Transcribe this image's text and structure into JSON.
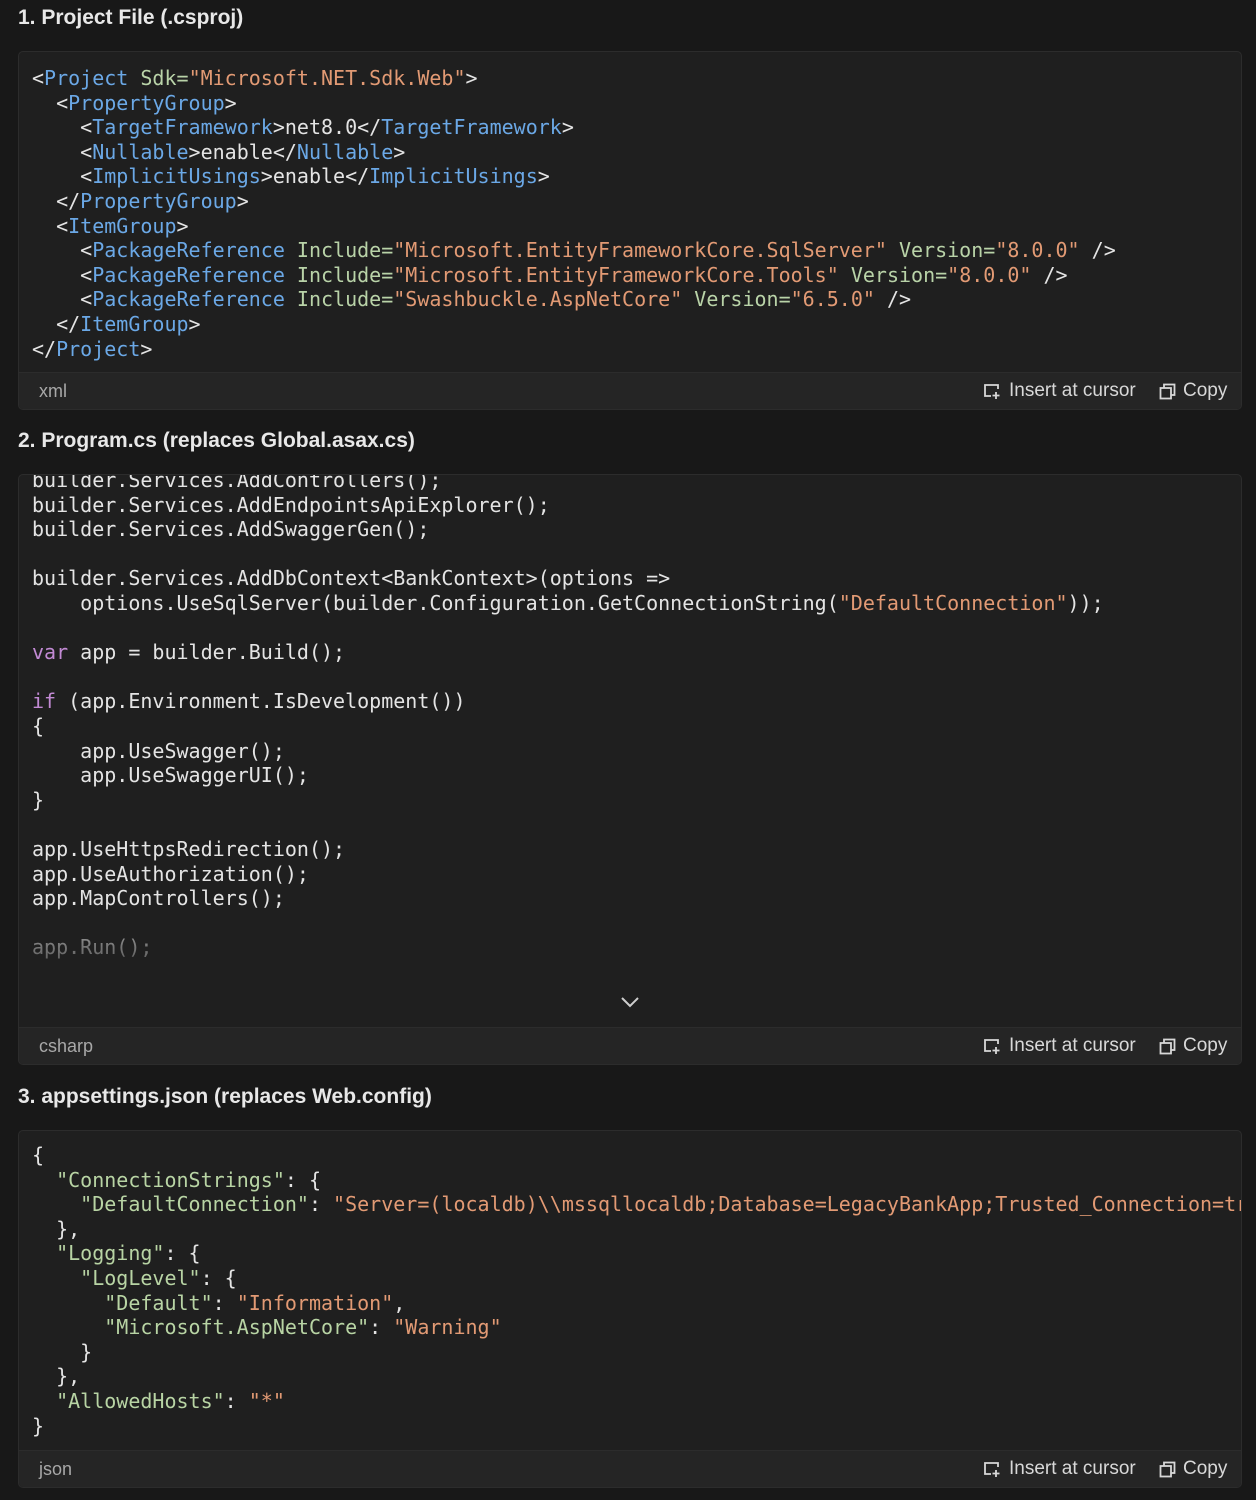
{
  "sections": [
    {
      "heading": "1. Project File (.csproj)",
      "language": "xml",
      "insert_label": "Insert at cursor",
      "copy_label": "Copy",
      "lines": [
        [
          {
            "t": "<",
            "c": "bracket"
          },
          {
            "t": "Project",
            "c": "tag"
          },
          {
            "t": " Sdk=",
            "c": "attr"
          },
          {
            "t": "\"Microsoft.NET.Sdk.Web\"",
            "c": "str"
          },
          {
            "t": ">",
            "c": "bracket"
          }
        ],
        [
          {
            "t": "  <",
            "c": "bracket"
          },
          {
            "t": "PropertyGroup",
            "c": "tag"
          },
          {
            "t": ">",
            "c": "bracket"
          }
        ],
        [
          {
            "t": "    <",
            "c": "bracket"
          },
          {
            "t": "TargetFramework",
            "c": "tag"
          },
          {
            "t": ">net8.0</",
            "c": "bracket"
          },
          {
            "t": "TargetFramework",
            "c": "tag"
          },
          {
            "t": ">",
            "c": "bracket"
          }
        ],
        [
          {
            "t": "    <",
            "c": "bracket"
          },
          {
            "t": "Nullable",
            "c": "tag"
          },
          {
            "t": ">enable</",
            "c": "bracket"
          },
          {
            "t": "Nullable",
            "c": "tag"
          },
          {
            "t": ">",
            "c": "bracket"
          }
        ],
        [
          {
            "t": "    <",
            "c": "bracket"
          },
          {
            "t": "ImplicitUsings",
            "c": "tag"
          },
          {
            "t": ">enable</",
            "c": "bracket"
          },
          {
            "t": "ImplicitUsings",
            "c": "tag"
          },
          {
            "t": ">",
            "c": "bracket"
          }
        ],
        [
          {
            "t": "  </",
            "c": "bracket"
          },
          {
            "t": "PropertyGroup",
            "c": "tag"
          },
          {
            "t": ">",
            "c": "bracket"
          }
        ],
        [
          {
            "t": "  <",
            "c": "bracket"
          },
          {
            "t": "ItemGroup",
            "c": "tag"
          },
          {
            "t": ">",
            "c": "bracket"
          }
        ],
        [
          {
            "t": "    <",
            "c": "bracket"
          },
          {
            "t": "PackageReference",
            "c": "tag"
          },
          {
            "t": " Include=",
            "c": "attr"
          },
          {
            "t": "\"Microsoft.EntityFrameworkCore.SqlServer\"",
            "c": "str"
          },
          {
            "t": " Version=",
            "c": "attr"
          },
          {
            "t": "\"8.0.0\"",
            "c": "str"
          },
          {
            "t": " />",
            "c": "bracket"
          }
        ],
        [
          {
            "t": "    <",
            "c": "bracket"
          },
          {
            "t": "PackageReference",
            "c": "tag"
          },
          {
            "t": " Include=",
            "c": "attr"
          },
          {
            "t": "\"Microsoft.EntityFrameworkCore.Tools\"",
            "c": "str"
          },
          {
            "t": " Version=",
            "c": "attr"
          },
          {
            "t": "\"8.0.0\"",
            "c": "str"
          },
          {
            "t": " />",
            "c": "bracket"
          }
        ],
        [
          {
            "t": "    <",
            "c": "bracket"
          },
          {
            "t": "PackageReference",
            "c": "tag"
          },
          {
            "t": " Include=",
            "c": "attr"
          },
          {
            "t": "\"Swashbuckle.AspNetCore\"",
            "c": "str"
          },
          {
            "t": " Version=",
            "c": "attr"
          },
          {
            "t": "\"6.5.0\"",
            "c": "str"
          },
          {
            "t": " />",
            "c": "bracket"
          }
        ],
        [
          {
            "t": "  </",
            "c": "bracket"
          },
          {
            "t": "ItemGroup",
            "c": "tag"
          },
          {
            "t": ">",
            "c": "bracket"
          }
        ],
        [
          {
            "t": "</",
            "c": "bracket"
          },
          {
            "t": "Project",
            "c": "tag"
          },
          {
            "t": ">",
            "c": "bracket"
          }
        ]
      ]
    },
    {
      "heading": "2. Program.cs (replaces Global.asax.cs)",
      "language": "csharp",
      "insert_label": "Insert at cursor",
      "copy_label": "Copy",
      "lines": [
        [
          {
            "t": "builder.Services.AddControllers();",
            "c": "plain"
          }
        ],
        [
          {
            "t": "builder.Services.AddEndpointsApiExplorer();",
            "c": "plain"
          }
        ],
        [
          {
            "t": "builder.Services.AddSwaggerGen();",
            "c": "plain"
          }
        ],
        [],
        [
          {
            "t": "builder.Services.AddDbContext<BankContext>(options =>",
            "c": "plain"
          }
        ],
        [
          {
            "t": "    options.UseSqlServer(builder.Configuration.GetConnectionString(",
            "c": "plain"
          },
          {
            "t": "\"DefaultConnection\"",
            "c": "str"
          },
          {
            "t": "));",
            "c": "plain"
          }
        ],
        [],
        [
          {
            "t": "var",
            "c": "kw"
          },
          {
            "t": " app = builder.Build();",
            "c": "plain"
          }
        ],
        [],
        [
          {
            "t": "if",
            "c": "kw"
          },
          {
            "t": " (app.Environment.IsDevelopment())",
            "c": "plain"
          }
        ],
        [
          {
            "t": "{",
            "c": "plain"
          }
        ],
        [
          {
            "t": "    app.UseSwagger();",
            "c": "plain"
          }
        ],
        [
          {
            "t": "    app.UseSwaggerUI();",
            "c": "plain"
          }
        ],
        [
          {
            "t": "}",
            "c": "plain"
          }
        ],
        [],
        [
          {
            "t": "app.UseHttpsRedirection();",
            "c": "plain"
          }
        ],
        [
          {
            "t": "app.UseAuthorization();",
            "c": "plain"
          }
        ],
        [
          {
            "t": "app.MapControllers();",
            "c": "plain"
          }
        ],
        [],
        [
          {
            "t": "app.Run();",
            "c": "plain"
          }
        ]
      ]
    },
    {
      "heading": "3. appsettings.json (replaces Web.config)",
      "language": "json",
      "insert_label": "Insert at cursor",
      "copy_label": "Copy",
      "lines": [
        [
          {
            "t": "{",
            "c": "plain"
          }
        ],
        [
          {
            "t": "  ",
            "c": "plain"
          },
          {
            "t": "\"ConnectionStrings\"",
            "c": "key"
          },
          {
            "t": ": {",
            "c": "plain"
          }
        ],
        [
          {
            "t": "    ",
            "c": "plain"
          },
          {
            "t": "\"DefaultConnection\"",
            "c": "key"
          },
          {
            "t": ": ",
            "c": "plain"
          },
          {
            "t": "\"Server=(localdb)\\\\mssqllocaldb;Database=LegacyBankApp;Trusted_Connection=true;M",
            "c": "str"
          }
        ],
        [
          {
            "t": "  },",
            "c": "plain"
          }
        ],
        [
          {
            "t": "  ",
            "c": "plain"
          },
          {
            "t": "\"Logging\"",
            "c": "key"
          },
          {
            "t": ": {",
            "c": "plain"
          }
        ],
        [
          {
            "t": "    ",
            "c": "plain"
          },
          {
            "t": "\"LogLevel\"",
            "c": "key"
          },
          {
            "t": ": {",
            "c": "plain"
          }
        ],
        [
          {
            "t": "      ",
            "c": "plain"
          },
          {
            "t": "\"Default\"",
            "c": "key"
          },
          {
            "t": ": ",
            "c": "plain"
          },
          {
            "t": "\"Information\"",
            "c": "str"
          },
          {
            "t": ",",
            "c": "plain"
          }
        ],
        [
          {
            "t": "      ",
            "c": "plain"
          },
          {
            "t": "\"Microsoft.AspNetCore\"",
            "c": "key"
          },
          {
            "t": ": ",
            "c": "plain"
          },
          {
            "t": "\"Warning\"",
            "c": "str"
          }
        ],
        [
          {
            "t": "    }",
            "c": "plain"
          }
        ],
        [
          {
            "t": "  },",
            "c": "plain"
          }
        ],
        [
          {
            "t": "  ",
            "c": "plain"
          },
          {
            "t": "\"AllowedHosts\"",
            "c": "key"
          },
          {
            "t": ": ",
            "c": "plain"
          },
          {
            "t": "\"*\"",
            "c": "str"
          }
        ],
        [
          {
            "t": "}",
            "c": "plain"
          }
        ]
      ]
    }
  ],
  "icons": {
    "insert": "insert-at-cursor-icon",
    "copy": "copy-icon",
    "expand": "chevron-down-icon"
  },
  "colors": {
    "background": "#181818",
    "block_bg": "#1f1f1f",
    "footer_bg": "#252525",
    "tag": "#6ba8e6",
    "attribute": "#b9d3a8",
    "string": "#e29a74",
    "keyword": "#c28ad4",
    "text": "#e4e4e4"
  }
}
